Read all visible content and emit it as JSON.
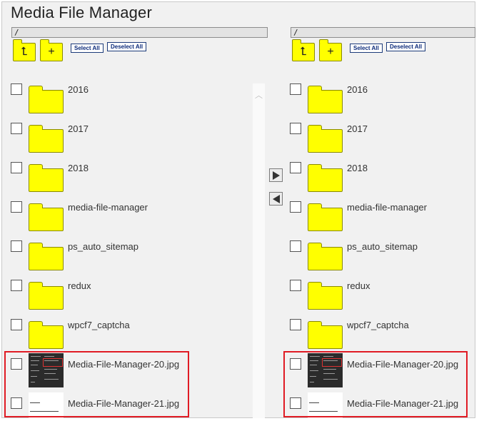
{
  "app": {
    "title": "Media File Manager"
  },
  "toolbar": {
    "up_icon": "folder-up-icon",
    "new_icon": "folder-plus-icon",
    "select_all": "Select All",
    "deselect_all": "Deselect All"
  },
  "left": {
    "path": "/",
    "items": [
      {
        "name": "2016",
        "type": "folder"
      },
      {
        "name": "2017",
        "type": "folder"
      },
      {
        "name": "2018",
        "type": "folder"
      },
      {
        "name": "media-file-manager",
        "type": "folder"
      },
      {
        "name": "ps_auto_sitemap",
        "type": "folder"
      },
      {
        "name": "redux",
        "type": "folder"
      },
      {
        "name": "wpcf7_captcha",
        "type": "folder"
      },
      {
        "name": "Media-File-Manager-20.jpg",
        "type": "image"
      },
      {
        "name": "Media-File-Manager-21.jpg",
        "type": "image"
      }
    ]
  },
  "right": {
    "path": "/",
    "items": [
      {
        "name": "2016",
        "type": "folder"
      },
      {
        "name": "2017",
        "type": "folder"
      },
      {
        "name": "2018",
        "type": "folder"
      },
      {
        "name": "media-file-manager",
        "type": "folder"
      },
      {
        "name": "ps_auto_sitemap",
        "type": "folder"
      },
      {
        "name": "redux",
        "type": "folder"
      },
      {
        "name": "wpcf7_captcha",
        "type": "folder"
      },
      {
        "name": "Media-File-Manager-20.jpg",
        "type": "image"
      },
      {
        "name": "Media-File-Manager-21.jpg",
        "type": "image"
      }
    ]
  },
  "transfer": {
    "right_icon": "arrow-right-icon",
    "left_icon": "arrow-left-icon"
  },
  "colors": {
    "folder": "#ffff00",
    "highlight": "#e01b24",
    "button_text": "#0b2a7a"
  }
}
